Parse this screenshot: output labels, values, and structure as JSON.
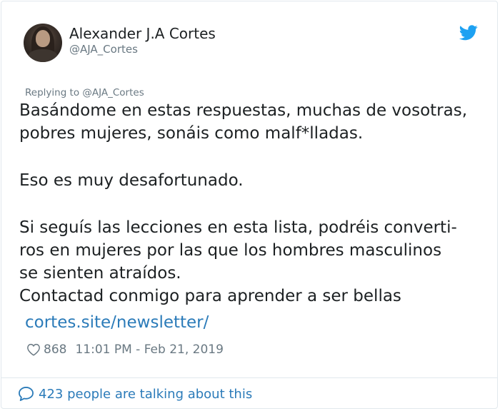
{
  "author": {
    "display_name": "Alexander J.A Cortes",
    "handle": "@AJA_Cortes"
  },
  "icons": {
    "brand": "twitter-bird-icon",
    "like": "heart-icon",
    "conversation": "speech-bubble-icon"
  },
  "colors": {
    "link": "#2b7bb9",
    "twitter_blue": "#1da1f2",
    "secondary_text": "#697882"
  },
  "tweet": {
    "replying_to": "Replying to @AJA_Cortes",
    "paragraphs": [
      [
        "Basándome en estas respuestas, muchas de vosotras,",
        "pobres mujeres, sonáis como malf*lladas."
      ],
      [
        "Eso es muy desafortunado."
      ],
      [
        "Si seguís las lecciones en esta lista, podréis converti-",
        "ros en mujeres por las que los hombres masculinos",
        "se sienten atraídos.",
        "Contactad conmigo para aprender a ser bellas"
      ]
    ],
    "link": "cortes.site/newsletter/",
    "likes": "868",
    "timestamp": "11:01 PM - Feb 21, 2019"
  },
  "footer": {
    "talking": "423 people are talking about this"
  }
}
